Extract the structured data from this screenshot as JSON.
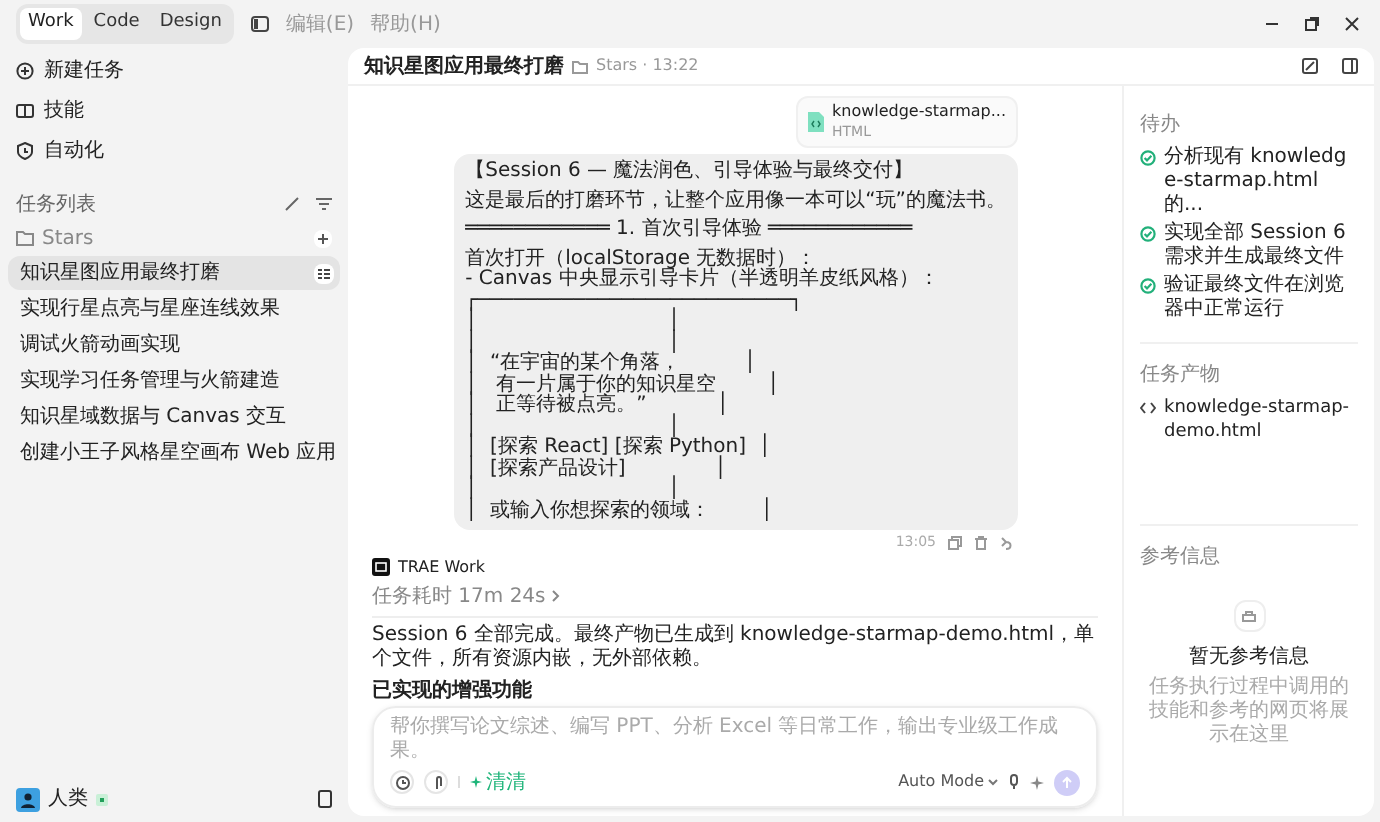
{
  "window": {
    "tabs": [
      {
        "label": "Work",
        "selected": true
      },
      {
        "label": "Code",
        "selected": false
      },
      {
        "label": "Design",
        "selected": false
      }
    ],
    "menu": [
      "编辑(E)",
      "帮助(H)"
    ]
  },
  "sidebar": {
    "actions": [
      {
        "label": "新建任务",
        "kind": "new"
      },
      {
        "label": "技能",
        "kind": "skills"
      },
      {
        "label": "自动化",
        "kind": "automation"
      }
    ],
    "task_list_title": "任务列表",
    "folder": "Stars",
    "tasks": [
      {
        "label": "知识星图应用最终打磨",
        "selected": true
      },
      {
        "label": "实现行星点亮与星座连线效果",
        "selected": false
      },
      {
        "label": "调试火箭动画实现",
        "selected": false
      },
      {
        "label": "实现学习任务管理与火箭建造",
        "selected": false
      },
      {
        "label": "知识星域数据与 Canvas 交互",
        "selected": false
      },
      {
        "label": "创建小王子风格星空画布 Web 应用",
        "selected": false
      }
    ],
    "user": {
      "name": "人类"
    }
  },
  "chat": {
    "title": "知识星图应用最终打磨",
    "meta": "Stars · 13:22",
    "attachment": {
      "name": "knowledge-starmap...",
      "type": "HTML"
    },
    "message_blocks": [
      [
        "【Session 6 — 魔法润色、引导体验与最终交付】"
      ],
      [
        "这是最后的打磨环节，让整个应用像一本可以“玩”的魔法书。"
      ],
      [
        "════════════ 1. 首次引导体验 ════════════"
      ],
      [
        "首次打开（localStorage 无数据时）：",
        "- Canvas 中央显示引导卡片（半透明羊皮纸风格）：",
        "┌──────────────────────────┐",
        "│                              │",
        "│                              │",
        "│  “在宇宙的某个角落，          │",
        "│   有一片属于你的知识星空        │",
        "│   正等待被点亮。”           │",
        "│                              │",
        "│  [探索 React] [探索 Python]  │",
        "│  [探索产品设计]              │",
        "│                              │",
        "│  或输入你想探索的领域：        │"
      ]
    ],
    "time": "13:05",
    "agent": "TRAE Work",
    "duration": "任务耗时 17m 24s",
    "summary": "Session 6 全部完成。最终产物已生成到 knowledge-starmap-demo.html，单个文件，所有资源内嵌，无外部依赖。",
    "heading": "已实现的增强功能",
    "input": {
      "placeholder": "帮你撰写论文综述、编写 PPT、分析 Excel 等日常工作，输出专业级工作成果。",
      "tag": "清清",
      "mode": "Auto Mode"
    }
  },
  "right_panel": {
    "todo_title": "待办",
    "todos": [
      {
        "label": "分析现有 knowledge-starmap.html 的...",
        "checked": true
      },
      {
        "label": "实现全部 Session 6 需求并生成最终文件",
        "checked": true
      },
      {
        "label": "验证最终文件在浏览器中正常运行",
        "checked": true
      }
    ],
    "output_title": "任务产物",
    "outputs": [
      "knowledge-starmap-demo.html"
    ],
    "reference_title": "参考信息",
    "empty_title": "暂无参考信息",
    "empty_text": "任务执行过程中调用的技能和参考的网页将展示在这里"
  }
}
